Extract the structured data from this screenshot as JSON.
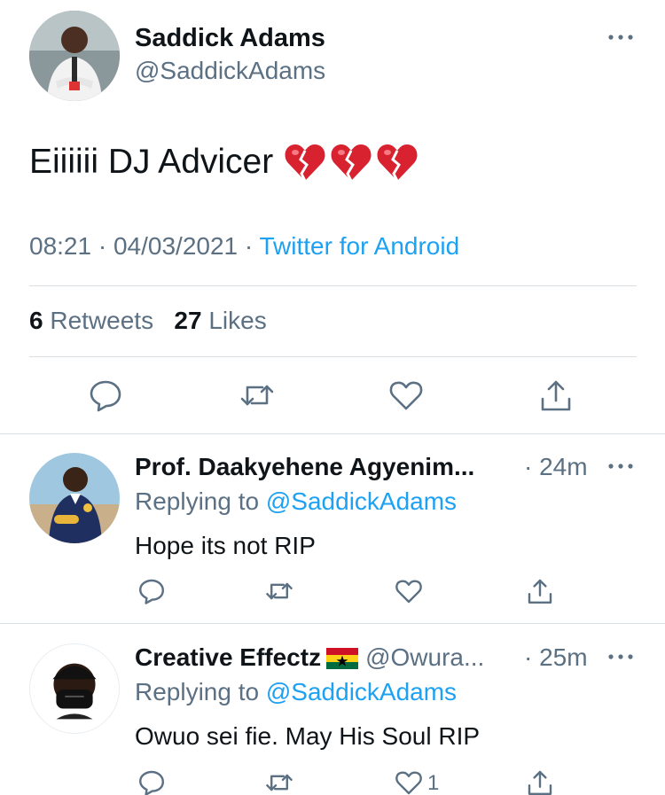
{
  "main_tweet": {
    "author_name": "Saddick Adams",
    "author_handle": "@SaddickAdams",
    "text": "Eiiiiii DJ Advicer",
    "emoji": "broken-heart",
    "time": "08:21",
    "date": "04/03/2021",
    "source": "Twitter for Android",
    "retweets_count": "6",
    "retweets_label": "Retweets",
    "likes_count": "27",
    "likes_label": "Likes",
    "separator": "·"
  },
  "replies": [
    {
      "author_name": "Prof. Daakyehene Agyenim...",
      "handle": "",
      "time": "· 24m",
      "replying_label": "Replying to",
      "replying_to": "@SaddickAdams",
      "text": "Hope its not RIP",
      "like_count": ""
    },
    {
      "author_name": "Creative Effectz",
      "handle": "@Owura...",
      "time": "· 25m",
      "replying_label": "Replying to",
      "replying_to": "@SaddickAdams",
      "text": "Owuo sei fie. May His Soul RIP",
      "like_count": "1"
    }
  ],
  "colors": {
    "link": "#1da1f2",
    "secondary": "#5b7083",
    "primary": "#0f1419",
    "divider": "#d9dee3"
  },
  "icons": [
    "reply-icon",
    "retweet-icon",
    "like-icon",
    "share-icon",
    "more-icon",
    "broken-heart-icon",
    "ghana-flag-icon"
  ]
}
